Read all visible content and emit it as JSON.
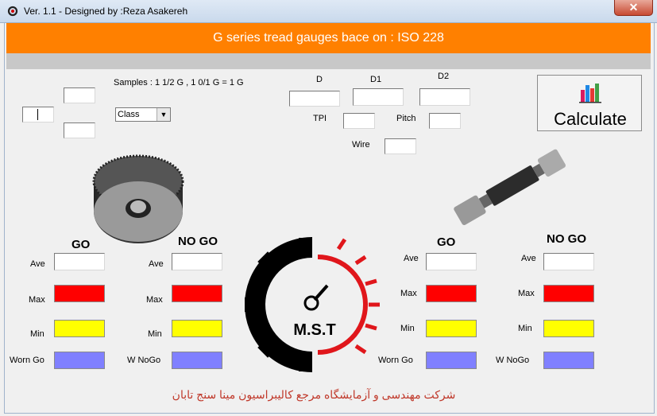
{
  "window": {
    "title": "Ver. 1.1 - Designed by :Reza Asakereh",
    "close": "✕"
  },
  "banner": "G series tread gauges bace on : ISO 228",
  "samples": "Samples : 1 1/2 G   ,   1 0/1 G = 1 G",
  "class_select": "Class",
  "labels": {
    "D": "D",
    "D1": "D1",
    "D2": "D2",
    "TPI": "TPI",
    "Pitch": "Pitch",
    "Wire": "Wire"
  },
  "calculate": "Calculate",
  "left_panel": {
    "go": "GO",
    "nogo": "NO GO",
    "go_rows": [
      "Ave",
      "Max",
      "Min",
      "Worn Go"
    ],
    "nogo_rows": [
      "Ave",
      "Max",
      "Min",
      "W NoGo"
    ]
  },
  "right_panel": {
    "go": "GO",
    "nogo": "NO GO",
    "go_rows": [
      "Ave",
      "Max",
      "Min",
      "Worn Go"
    ],
    "nogo_rows": [
      "Ave",
      "Max",
      "Min",
      "W NoGo"
    ]
  },
  "logo_text": "M.S.T",
  "footer": "شرکت مهندسی و آزمایشگاه مرجع کالیبراسیون مینا سنج تابان",
  "colors": {
    "banner": "#ff8000",
    "max": "#ff0000",
    "min": "#ffff00",
    "worn": "#8080ff",
    "footer": "#c0392b"
  }
}
